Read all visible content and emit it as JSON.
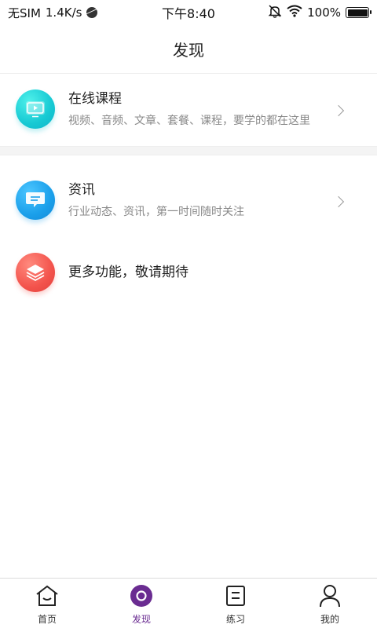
{
  "status_bar": {
    "carrier": "无SIM",
    "speed": "1.4K/s",
    "time": "下午8:40",
    "battery": "100%",
    "battery_level": 1.0
  },
  "header": {
    "title": "发现"
  },
  "list": [
    {
      "title": "在线课程",
      "subtitle": "视频、音频、文章、套餐、课程，要学的都在这里",
      "icon": "play-screen-icon",
      "color": "#16c9d3"
    },
    {
      "title": "资讯",
      "subtitle": "行业动态、资讯，第一时间随时关注",
      "icon": "message-icon",
      "color": "#1a9fea"
    },
    {
      "title": "更多功能，敬请期待",
      "icon": "layers-icon",
      "color": "#f3534c"
    }
  ],
  "tabs": [
    {
      "label": "首页",
      "icon": "home-icon"
    },
    {
      "label": "发现",
      "icon": "discover-icon",
      "active": true,
      "color": "#6a2c91"
    },
    {
      "label": "练习",
      "icon": "practice-icon"
    },
    {
      "label": "我的",
      "icon": "profile-icon"
    }
  ]
}
